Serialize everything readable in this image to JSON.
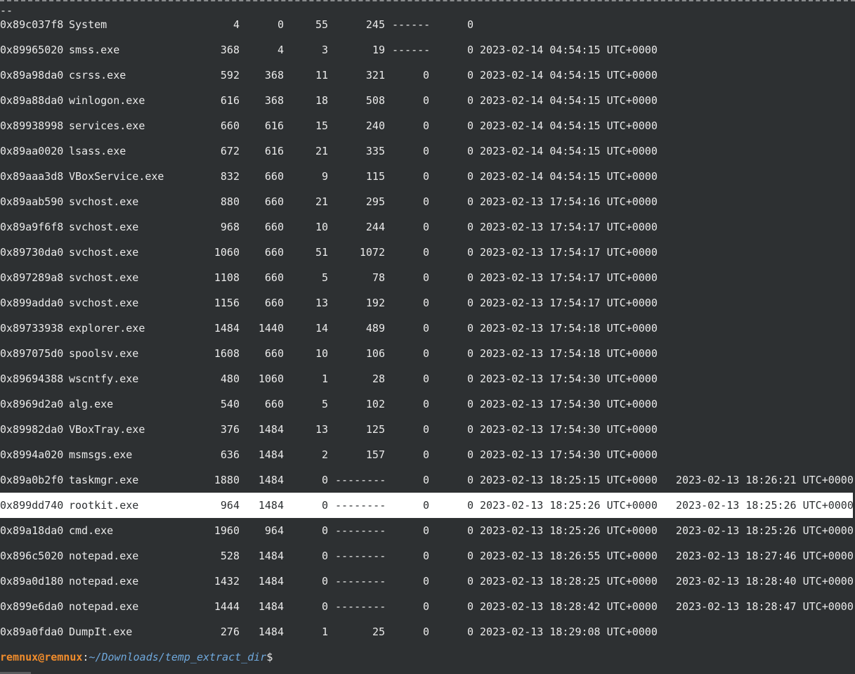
{
  "terminal": {
    "separator_tail": "--",
    "rows": [
      {
        "offset": "0x89c037f8",
        "name": "System",
        "pid": "4",
        "ppid": "0",
        "threads": "55",
        "handles": "245",
        "session": "------",
        "wow64": "0",
        "start": "",
        "exit": ""
      },
      {
        "offset": "0x89965020",
        "name": "smss.exe",
        "pid": "368",
        "ppid": "4",
        "threads": "3",
        "handles": "19",
        "session": "------",
        "wow64": "0",
        "start": "2023-02-14 04:54:15 UTC+0000",
        "exit": ""
      },
      {
        "offset": "0x89a98da0",
        "name": "csrss.exe",
        "pid": "592",
        "ppid": "368",
        "threads": "11",
        "handles": "321",
        "session": "0",
        "wow64": "0",
        "start": "2023-02-14 04:54:15 UTC+0000",
        "exit": ""
      },
      {
        "offset": "0x89a88da0",
        "name": "winlogon.exe",
        "pid": "616",
        "ppid": "368",
        "threads": "18",
        "handles": "508",
        "session": "0",
        "wow64": "0",
        "start": "2023-02-14 04:54:15 UTC+0000",
        "exit": ""
      },
      {
        "offset": "0x89938998",
        "name": "services.exe",
        "pid": "660",
        "ppid": "616",
        "threads": "15",
        "handles": "240",
        "session": "0",
        "wow64": "0",
        "start": "2023-02-14 04:54:15 UTC+0000",
        "exit": ""
      },
      {
        "offset": "0x89aa0020",
        "name": "lsass.exe",
        "pid": "672",
        "ppid": "616",
        "threads": "21",
        "handles": "335",
        "session": "0",
        "wow64": "0",
        "start": "2023-02-14 04:54:15 UTC+0000",
        "exit": ""
      },
      {
        "offset": "0x89aaa3d8",
        "name": "VBoxService.exe",
        "pid": "832",
        "ppid": "660",
        "threads": "9",
        "handles": "115",
        "session": "0",
        "wow64": "0",
        "start": "2023-02-14 04:54:15 UTC+0000",
        "exit": ""
      },
      {
        "offset": "0x89aab590",
        "name": "svchost.exe",
        "pid": "880",
        "ppid": "660",
        "threads": "21",
        "handles": "295",
        "session": "0",
        "wow64": "0",
        "start": "2023-02-13 17:54:16 UTC+0000",
        "exit": ""
      },
      {
        "offset": "0x89a9f6f8",
        "name": "svchost.exe",
        "pid": "968",
        "ppid": "660",
        "threads": "10",
        "handles": "244",
        "session": "0",
        "wow64": "0",
        "start": "2023-02-13 17:54:17 UTC+0000",
        "exit": ""
      },
      {
        "offset": "0x89730da0",
        "name": "svchost.exe",
        "pid": "1060",
        "ppid": "660",
        "threads": "51",
        "handles": "1072",
        "session": "0",
        "wow64": "0",
        "start": "2023-02-13 17:54:17 UTC+0000",
        "exit": ""
      },
      {
        "offset": "0x897289a8",
        "name": "svchost.exe",
        "pid": "1108",
        "ppid": "660",
        "threads": "5",
        "handles": "78",
        "session": "0",
        "wow64": "0",
        "start": "2023-02-13 17:54:17 UTC+0000",
        "exit": ""
      },
      {
        "offset": "0x899adda0",
        "name": "svchost.exe",
        "pid": "1156",
        "ppid": "660",
        "threads": "13",
        "handles": "192",
        "session": "0",
        "wow64": "0",
        "start": "2023-02-13 17:54:17 UTC+0000",
        "exit": ""
      },
      {
        "offset": "0x89733938",
        "name": "explorer.exe",
        "pid": "1484",
        "ppid": "1440",
        "threads": "14",
        "handles": "489",
        "session": "0",
        "wow64": "0",
        "start": "2023-02-13 17:54:18 UTC+0000",
        "exit": ""
      },
      {
        "offset": "0x897075d0",
        "name": "spoolsv.exe",
        "pid": "1608",
        "ppid": "660",
        "threads": "10",
        "handles": "106",
        "session": "0",
        "wow64": "0",
        "start": "2023-02-13 17:54:18 UTC+0000",
        "exit": ""
      },
      {
        "offset": "0x89694388",
        "name": "wscntfy.exe",
        "pid": "480",
        "ppid": "1060",
        "threads": "1",
        "handles": "28",
        "session": "0",
        "wow64": "0",
        "start": "2023-02-13 17:54:30 UTC+0000",
        "exit": ""
      },
      {
        "offset": "0x8969d2a0",
        "name": "alg.exe",
        "pid": "540",
        "ppid": "660",
        "threads": "5",
        "handles": "102",
        "session": "0",
        "wow64": "0",
        "start": "2023-02-13 17:54:30 UTC+0000",
        "exit": ""
      },
      {
        "offset": "0x89982da0",
        "name": "VBoxTray.exe",
        "pid": "376",
        "ppid": "1484",
        "threads": "13",
        "handles": "125",
        "session": "0",
        "wow64": "0",
        "start": "2023-02-13 17:54:30 UTC+0000",
        "exit": ""
      },
      {
        "offset": "0x8994a020",
        "name": "msmsgs.exe",
        "pid": "636",
        "ppid": "1484",
        "threads": "2",
        "handles": "157",
        "session": "0",
        "wow64": "0",
        "start": "2023-02-13 17:54:30 UTC+0000",
        "exit": ""
      },
      {
        "offset": "0x89a0b2f0",
        "name": "taskmgr.exe",
        "pid": "1880",
        "ppid": "1484",
        "threads": "0",
        "handles": "--------",
        "session": "0",
        "wow64": "0",
        "start": "2023-02-13 18:25:15 UTC+0000",
        "exit": "2023-02-13 18:26:21 UTC+0000"
      },
      {
        "offset": "0x899dd740",
        "name": "rootkit.exe",
        "pid": "964",
        "ppid": "1484",
        "threads": "0",
        "handles": "--------",
        "session": "0",
        "wow64": "0",
        "start": "2023-02-13 18:25:26 UTC+0000",
        "exit": "2023-02-13 18:25:26 UTC+0000",
        "selected": true
      },
      {
        "offset": "0x89a18da0",
        "name": "cmd.exe",
        "pid": "1960",
        "ppid": "964",
        "threads": "0",
        "handles": "--------",
        "session": "0",
        "wow64": "0",
        "start": "2023-02-13 18:25:26 UTC+0000",
        "exit": "2023-02-13 18:25:26 UTC+0000"
      },
      {
        "offset": "0x896c5020",
        "name": "notepad.exe",
        "pid": "528",
        "ppid": "1484",
        "threads": "0",
        "handles": "--------",
        "session": "0",
        "wow64": "0",
        "start": "2023-02-13 18:26:55 UTC+0000",
        "exit": "2023-02-13 18:27:46 UTC+0000"
      },
      {
        "offset": "0x89a0d180",
        "name": "notepad.exe",
        "pid": "1432",
        "ppid": "1484",
        "threads": "0",
        "handles": "--------",
        "session": "0",
        "wow64": "0",
        "start": "2023-02-13 18:28:25 UTC+0000",
        "exit": "2023-02-13 18:28:40 UTC+0000"
      },
      {
        "offset": "0x899e6da0",
        "name": "notepad.exe",
        "pid": "1444",
        "ppid": "1484",
        "threads": "0",
        "handles": "--------",
        "session": "0",
        "wow64": "0",
        "start": "2023-02-13 18:28:42 UTC+0000",
        "exit": "2023-02-13 18:28:47 UTC+0000"
      },
      {
        "offset": "0x89a0fda0",
        "name": "DumpIt.exe",
        "pid": "276",
        "ppid": "1484",
        "threads": "1",
        "handles": "25",
        "session": "0",
        "wow64": "0",
        "start": "2023-02-13 18:29:08 UTC+0000",
        "exit": ""
      }
    ],
    "prompt": {
      "user_host": "remnux@remnux",
      "colon": ":",
      "path": "~/Downloads/temp_extract_dir",
      "dollar": "$"
    },
    "colors": {
      "background": "#2d3032",
      "text": "#eaeaea",
      "prompt_user": "#f08c2c",
      "prompt_path": "#6fa8dc",
      "selection": "#ffffff"
    }
  }
}
